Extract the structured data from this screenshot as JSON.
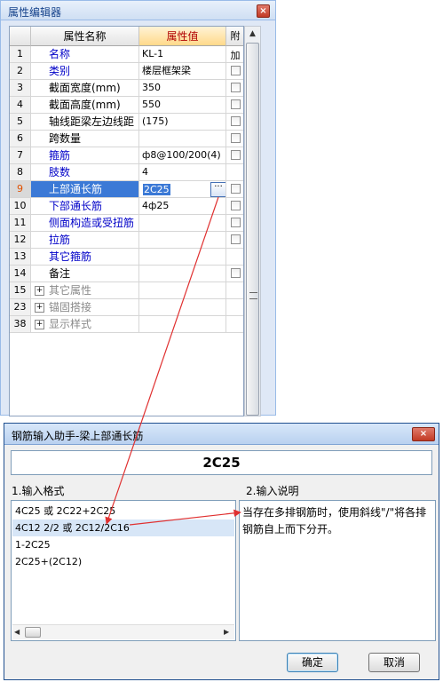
{
  "property_editor": {
    "title": "属性编辑器",
    "columns": {
      "name": "属性名称",
      "value": "属性值",
      "extra": "附加"
    },
    "rows": [
      {
        "num": "1",
        "name": "名称",
        "value": "KL-1",
        "name_style": "blue",
        "checkbox": false
      },
      {
        "num": "2",
        "name": "类别",
        "value": "楼层框架梁",
        "name_style": "blue",
        "checkbox": true
      },
      {
        "num": "3",
        "name": "截面宽度(mm)",
        "value": "350",
        "name_style": "black",
        "checkbox": true
      },
      {
        "num": "4",
        "name": "截面高度(mm)",
        "value": "550",
        "name_style": "black",
        "checkbox": true
      },
      {
        "num": "5",
        "name": "轴线距梁左边线距",
        "value": "(175)",
        "name_style": "black",
        "checkbox": true
      },
      {
        "num": "6",
        "name": "跨数量",
        "value": "",
        "name_style": "black",
        "checkbox": true
      },
      {
        "num": "7",
        "name": "箍筋",
        "value": "ф8@100/200(4)",
        "name_style": "blue",
        "checkbox": true
      },
      {
        "num": "8",
        "name": "肢数",
        "value": "4",
        "name_style": "blue",
        "checkbox": false
      },
      {
        "num": "9",
        "name": "上部通长筋",
        "value": "2C25",
        "name_style": "selected",
        "checkbox": true
      },
      {
        "num": "10",
        "name": "下部通长筋",
        "value": "4ф25",
        "name_style": "blue",
        "checkbox": true
      },
      {
        "num": "11",
        "name": "侧面构造或受扭筋",
        "value": "",
        "name_style": "blue",
        "checkbox": true
      },
      {
        "num": "12",
        "name": "拉筋",
        "value": "",
        "name_style": "blue",
        "checkbox": true
      },
      {
        "num": "13",
        "name": "其它箍筋",
        "value": "",
        "name_style": "blue",
        "checkbox": false
      },
      {
        "num": "14",
        "name": "备注",
        "value": "",
        "name_style": "black",
        "checkbox": true
      },
      {
        "num": "15",
        "name": "其它属性",
        "value": "",
        "name_style": "group",
        "checkbox": false
      },
      {
        "num": "23",
        "name": "锚固搭接",
        "value": "",
        "name_style": "group",
        "checkbox": false
      },
      {
        "num": "38",
        "name": "显示样式",
        "value": "",
        "name_style": "group",
        "checkbox": false
      }
    ],
    "ellipsis": "···",
    "scroll_up": "▲"
  },
  "rebar_dialog": {
    "title": "钢筋输入助手-梁上部通长筋",
    "close": "×",
    "current_value": "2C25",
    "format_label": "1.输入格式",
    "description_label": "2.输入说明",
    "formats": [
      "4C25 或 2C22+2C25",
      "4C12 2/2 或 2C12/2C16",
      "1-2C25",
      "2C25+(2C12)"
    ],
    "highlighted_format": 1,
    "description": "当存在多排钢筋时，使用斜线\"/\"将各排钢筋自上而下分开。",
    "ok_label": "确定",
    "cancel_label": "取消",
    "scroll_left": "◀",
    "scroll_right": "▶"
  },
  "colors": {
    "annotation_arrow": "#e03030",
    "selection": "#3b79d6",
    "link_text": "#0000c8"
  }
}
